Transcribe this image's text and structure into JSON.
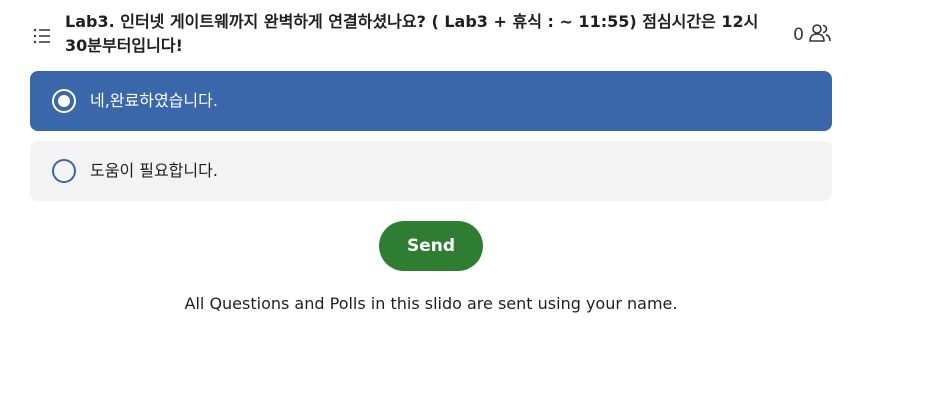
{
  "header": {
    "list_icon": "list-icon",
    "question": "Lab3. 인터넷 게이트웨까지 완벽하게 연결하셨나요? ( Lab3 + 휴식 : ~ 11:55) 점심시간은 12시 30분부터입니다!",
    "participant_count": "0",
    "participants_icon": "users-icon"
  },
  "options": [
    {
      "label": "네,완료하였습니다.",
      "selected": true
    },
    {
      "label": "도움이 필요합니다.",
      "selected": false
    }
  ],
  "send_label": "Send",
  "footnote": "All Questions and Polls in this slido are sent using your name.",
  "colors": {
    "selected_bg": "#3a66aa",
    "unselected_bg": "#f3f3f3",
    "send_bg": "#2e7d32"
  }
}
